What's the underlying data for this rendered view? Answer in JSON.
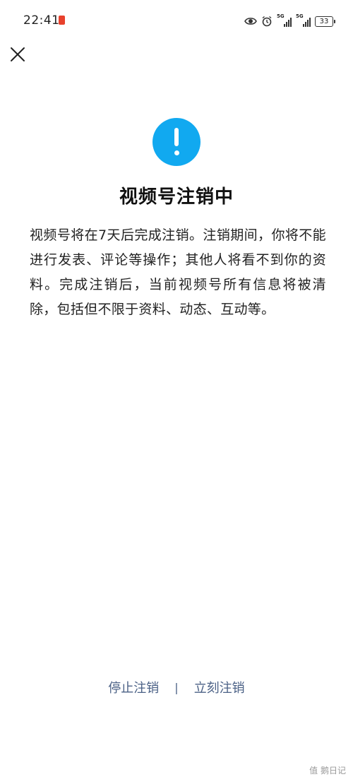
{
  "status_bar": {
    "time": "22:41",
    "network_1": "5G",
    "network_2": "5G",
    "battery": "33"
  },
  "dialog": {
    "title": "视频号注销中",
    "description": "视频号将在7天后完成注销。注销期间，你将不能进行发表、评论等操作；其他人将看不到你的资料。完成注销后，当前视频号所有信息将被清除，包括但不限于资料、动态、互动等。"
  },
  "actions": {
    "stop_label": "停止注销",
    "separator": "|",
    "immediate_label": "立刻注销"
  },
  "watermark": "值 鹅日记",
  "icons": {
    "close": "close-icon",
    "alert": "exclamation-circle-icon",
    "eye": "eye-icon",
    "alarm": "alarm-icon"
  },
  "colors": {
    "alert_blue": "#11a9f0",
    "link_color": "#4b6186",
    "notification_red": "#e8412c"
  }
}
